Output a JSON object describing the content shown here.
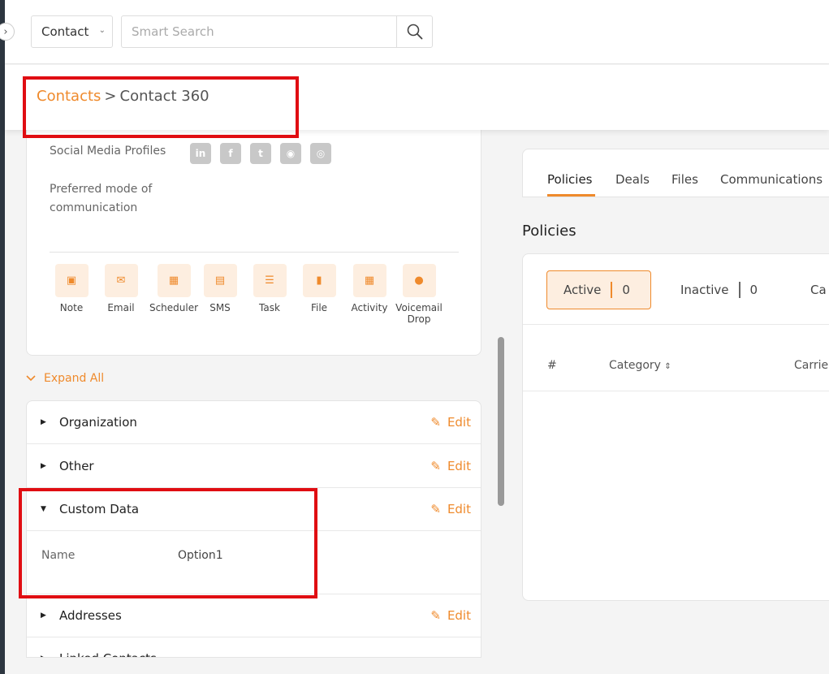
{
  "topbar": {
    "module_select": "Contact",
    "search_placeholder": "Smart Search"
  },
  "breadcrumb": {
    "parent": "Contacts",
    "separator": ">",
    "current": "Contact 360"
  },
  "profile_card": {
    "social_label": "Social Media Profiles",
    "social_icons": [
      "linkedin-icon",
      "facebook-icon",
      "twitter-icon",
      "instagram-icon",
      "website-icon"
    ],
    "preferred_label": "Preferred mode of communication",
    "actions": [
      {
        "label": "Note",
        "icon": "note-icon"
      },
      {
        "label": "Email",
        "icon": "email-icon"
      },
      {
        "label": "Scheduler",
        "icon": "scheduler-icon"
      },
      {
        "label": "SMS",
        "icon": "sms-icon"
      },
      {
        "label": "Task",
        "icon": "task-icon"
      },
      {
        "label": "File",
        "icon": "file-icon"
      },
      {
        "label": "Activity",
        "icon": "activity-icon"
      },
      {
        "label": "Voicemail Drop",
        "icon": "voicemail-icon"
      }
    ]
  },
  "expand_all": "Expand All",
  "sections": {
    "edit_label": "Edit",
    "items": [
      {
        "title": "Organization",
        "expanded": false
      },
      {
        "title": "Other",
        "expanded": false
      },
      {
        "title": "Custom Data",
        "expanded": true
      },
      {
        "title": "Addresses",
        "expanded": false
      },
      {
        "title": "Linked Contacts",
        "expanded": false
      }
    ],
    "custom_data_field": {
      "name": "Name",
      "value": "Option1"
    }
  },
  "right_tabs": [
    "Policies",
    "Deals",
    "Files",
    "Communications"
  ],
  "policies": {
    "title": "Policies",
    "statuses": [
      {
        "label": "Active",
        "count": "0"
      },
      {
        "label": "Inactive",
        "count": "0"
      },
      {
        "label": "Ca",
        "count": ""
      }
    ],
    "columns": [
      "#",
      "Category",
      "Carrie"
    ]
  },
  "colors": {
    "accent": "#ef8a2c",
    "highlight": "#e00d12"
  }
}
